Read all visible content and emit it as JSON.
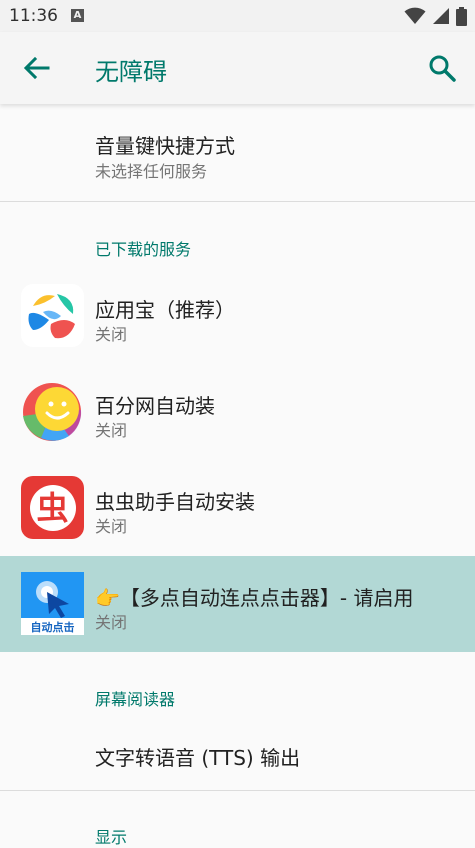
{
  "status_bar": {
    "time": "11:36",
    "notif_letter": "A"
  },
  "toolbar": {
    "title": "无障碍"
  },
  "shortcut": {
    "title": "音量键快捷方式",
    "subtitle": "未选择任何服务"
  },
  "sections": {
    "downloaded": "已下载的服务",
    "screen_reader": "屏幕阅读器",
    "display": "显示"
  },
  "services": [
    {
      "name": "应用宝（推荐）",
      "status": "关闭",
      "icon": "yingyongbao-icon"
    },
    {
      "name": "百分网自动装",
      "status": "关闭",
      "icon": "baifenwang-icon"
    },
    {
      "name": "虫虫助手自动安装",
      "status": "关闭",
      "icon": "chongchong-icon",
      "icon_text": "虫"
    },
    {
      "name": "👉【多点自动连点点击器】- 请启用",
      "status": "关闭",
      "icon": "auto-click-icon",
      "icon_text": "自动点击"
    }
  ],
  "tts": {
    "title": "文字转语音 (TTS) 输出"
  },
  "colors": {
    "accent": "#00796b",
    "highlight": "#b2d8d5"
  }
}
